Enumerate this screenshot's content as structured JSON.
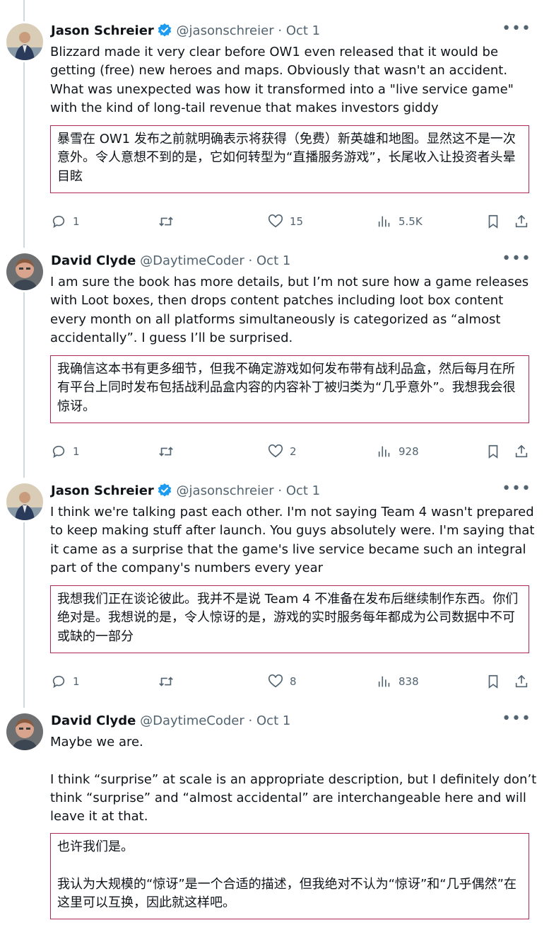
{
  "tweets": [
    {
      "name": "Jason Schreier",
      "handle": "@jasonschreier",
      "sep": "·",
      "date": "Oct 1",
      "verified": true,
      "body": [
        "Blizzard made it very clear before OW1 even released that it would be getting (free) new heroes and maps. Obviously that wasn't an accident. What was unexpected was how it transformed into a \"live service game\" with the kind of long-tail revenue that makes investors giddy"
      ],
      "translation": [
        "暴雪在 OW1 发布之前就明确表示将获得（免费）新英雄和地图。显然这不是一次意外。令人意想不到的是，它如何转型为“直播服务游戏”，长尾收入让投资者头晕目眩"
      ],
      "replies": "1",
      "likes": "15",
      "views": "5.5K"
    },
    {
      "name": "David Clyde",
      "handle": "@DaytimeCoder",
      "sep": "·",
      "date": "Oct 1",
      "verified": false,
      "body": [
        "I am sure the book has more details, but I’m not sure how a game releases with Loot boxes, then drops content patches including loot box content every month on all platforms simultaneously is categorized as “almost accidentally”. I guess I’ll be surprised."
      ],
      "translation": [
        "我确信这本书有更多细节，但我不确定游戏如何发布带有战利品盒，然后每月在所有平台上同时发布包括战利品盒内容的内容补丁被归类为“几乎意外”。我想我会很惊讶。"
      ],
      "replies": "1",
      "likes": "2",
      "views": "928"
    },
    {
      "name": "Jason Schreier",
      "handle": "@jasonschreier",
      "sep": "·",
      "date": "Oct 1",
      "verified": true,
      "body": [
        "I think we're talking past each other. I'm not saying Team 4 wasn't prepared to keep making stuff after launch. You guys absolutely were. I'm saying that it came as a surprise that the game's live service became such an integral part of the company's numbers every year"
      ],
      "translation": [
        "我想我们正在谈论彼此。我并不是说 Team 4 不准备在发布后继续制作东西。你们绝对是。我想说的是，令人惊讶的是，游戏的实时服务每年都成为公司数据中不可或缺的一部分"
      ],
      "replies": "1",
      "likes": "8",
      "views": "838"
    },
    {
      "name": "David Clyde",
      "handle": "@DaytimeCoder",
      "sep": "·",
      "date": "Oct 1",
      "verified": false,
      "body": [
        "Maybe we are.",
        "I think “surprise” at scale is an appropriate description, but I definitely don’t think “surprise” and “almost accidental” are interchangeable here and will leave it at that."
      ],
      "translation": [
        "也许我们是。",
        "我认为大规模的“惊讶”是一个合适的描述，但我绝对不认为“惊讶”和“几乎偶然”在这里可以互换，因此就这样吧。"
      ]
    }
  ],
  "icons": {
    "more": "more-icon",
    "reply": "reply-icon",
    "retweet": "retweet-icon",
    "like": "heart-icon",
    "views": "views-icon",
    "bookmark": "bookmark-icon",
    "share": "share-icon",
    "verified": "verified-badge-icon"
  },
  "colors": {
    "verified": "#1d9bf0",
    "translation_border": "#b0275a",
    "secondary_text": "#536471",
    "thread_line": "#cfd9de"
  }
}
